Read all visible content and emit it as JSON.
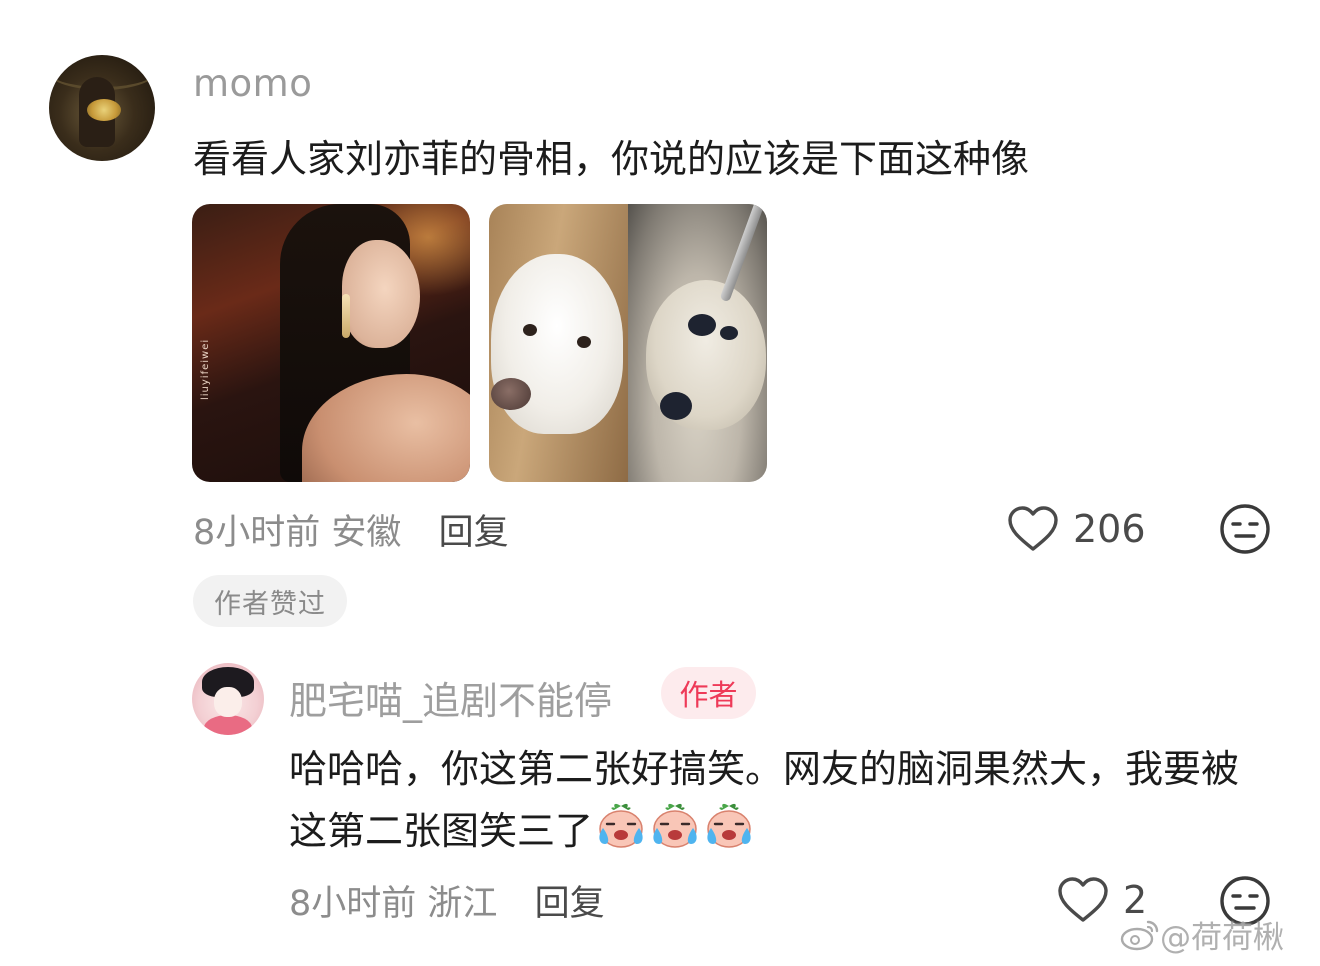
{
  "main_comment": {
    "username": "momo",
    "text": "看看人家刘亦菲的骨相，你说的应该是下面这种像",
    "photo1_watermark": "liuyifeiwei",
    "time": "8小时前",
    "location": "安徽",
    "reply_label": "回复",
    "like_count": "206",
    "author_liked_label": "作者赞过"
  },
  "reply_comment": {
    "username": "肥宅喵_追剧不能停",
    "author_badge": "作者",
    "text": "哈哈哈，你这第二张好搞笑。网友的脑洞果然大，我要被这第二张图笑三了",
    "emoji_count": 3,
    "time": "8小时前",
    "location": "浙江",
    "reply_label": "回复",
    "like_count": "2"
  },
  "watermark": {
    "text": "@荷荷楸"
  },
  "icons": {
    "like": "heart-outline-icon",
    "reaction": "neutral-face-icon",
    "emoji": "crying-peach-emoji",
    "weibo": "weibo-logo-icon"
  },
  "colors": {
    "author_badge_text": "#ee3a58",
    "author_badge_bg": "#fdebed",
    "muted_text": "#8c8c8c",
    "username": "#9a9a9a"
  }
}
